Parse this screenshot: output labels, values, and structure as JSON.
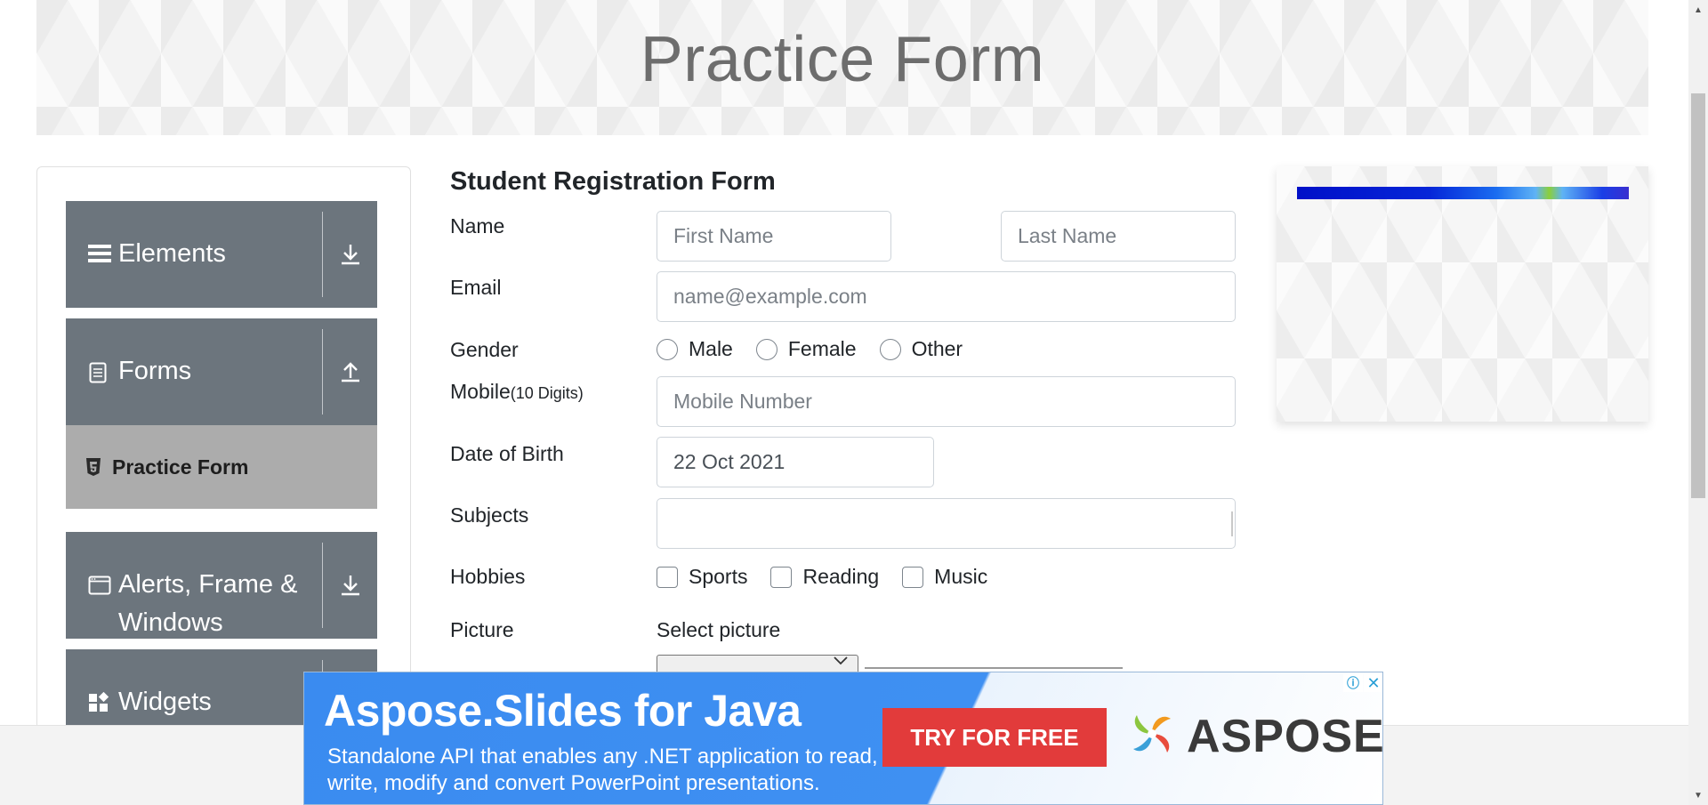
{
  "header": {
    "title": "Practice Form"
  },
  "sidebar": {
    "groups": [
      {
        "label": "Elements",
        "icon": "hamburger-icon",
        "arrow": "download-arrow-icon"
      },
      {
        "label": "Forms",
        "icon": "document-icon",
        "arrow": "upload-arrow-icon"
      },
      {
        "label": "Alerts, Frame &",
        "label2": "Windows",
        "icon": "browser-window-icon",
        "arrow": "download-arrow-icon"
      },
      {
        "label": "Widgets",
        "icon": "widgets-icon",
        "arrow": "download-arrow-icon"
      }
    ],
    "sub_items": [
      {
        "label": "Practice Form",
        "icon": "html5-icon",
        "active": true
      }
    ]
  },
  "form": {
    "title": "Student Registration Form",
    "labels": {
      "name": "Name",
      "email": "Email",
      "gender": "Gender",
      "mobile": "Mobile",
      "mobile_hint": "(10 Digits)",
      "dob": "Date of Birth",
      "subjects": "Subjects",
      "hobbies": "Hobbies",
      "picture": "Picture"
    },
    "first_name": {
      "placeholder": "First Name",
      "value": ""
    },
    "last_name": {
      "placeholder": "Last Name",
      "value": ""
    },
    "email": {
      "placeholder": "name@example.com",
      "value": ""
    },
    "gender_options": [
      "Male",
      "Female",
      "Other"
    ],
    "mobile": {
      "placeholder": "Mobile Number",
      "value": ""
    },
    "dob": {
      "value": "22 Oct 2021"
    },
    "subjects": {
      "value": ""
    },
    "hobby_options": [
      "Sports",
      "Reading",
      "Music"
    ],
    "picture_label": "Select picture"
  },
  "ads": {
    "bottom": {
      "title": "Aspose.Slides for Java",
      "description": "Standalone API that enables any .NET application to read, write, modify and convert PowerPoint presentations.",
      "cta": "TRY FOR FREE",
      "brand": "ASPOSE",
      "info_icon": "info-icon",
      "close_icon": "close-icon"
    }
  },
  "colors": {
    "sidebar_group_bg": "#6c757d",
    "sidebar_active_bg": "#acacac",
    "ad_blue": "#3f90f2",
    "ad_cta_red": "#e23b3b"
  }
}
